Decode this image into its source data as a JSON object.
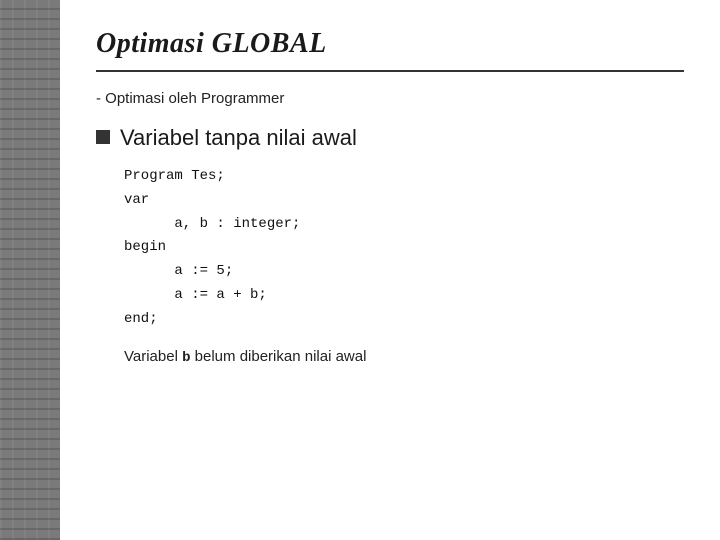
{
  "sidebar": {
    "label": "sidebar"
  },
  "header": {
    "title": "Optimasi GLOBAL",
    "subtitle": "- Optimasi oleh Programmer"
  },
  "section": {
    "bullet_label": "Variabel tanpa nilai awal"
  },
  "code": {
    "line1": "Program Tes;",
    "line2": "var",
    "line3": "      a, b : integer;",
    "line4": "begin",
    "line5": "      a := 5;",
    "line6": "      a := a + b;",
    "line7": "end;"
  },
  "footer": {
    "prefix": "Variabel ",
    "var": "b",
    "suffix": "  belum diberikan nilai awal"
  }
}
